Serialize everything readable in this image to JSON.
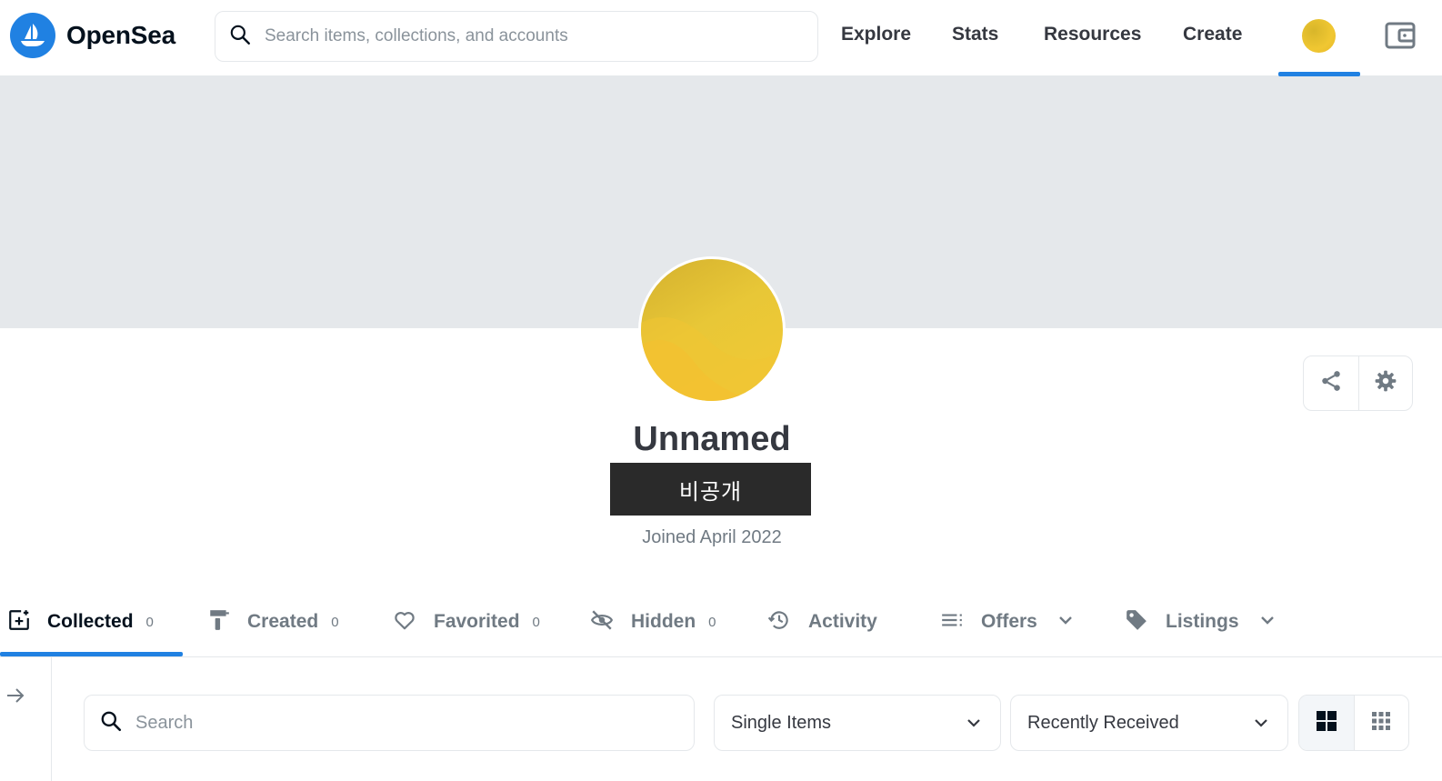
{
  "header": {
    "brand": "OpenSea",
    "search_placeholder": "Search items, collections, and accounts",
    "nav": [
      "Explore",
      "Stats",
      "Resources",
      "Create"
    ]
  },
  "profile": {
    "name": "Unnamed",
    "address_badge": "비공개",
    "joined": "Joined April 2022"
  },
  "tabs": [
    {
      "label": "Collected",
      "count": "0",
      "icon": "collected-icon"
    },
    {
      "label": "Created",
      "count": "0",
      "icon": "paintbrush-icon"
    },
    {
      "label": "Favorited",
      "count": "0",
      "icon": "heart-icon"
    },
    {
      "label": "Hidden",
      "count": "0",
      "icon": "eye-off-icon"
    },
    {
      "label": "Activity",
      "icon": "history-icon"
    },
    {
      "label": "Offers",
      "icon": "list-icon"
    },
    {
      "label": "Listings",
      "icon": "tag-icon"
    }
  ],
  "filters": {
    "search_placeholder": "Search",
    "type_selected": "Single Items",
    "sort_selected": "Recently Received"
  },
  "colors": {
    "accent": "#2081e2",
    "banner": "#e5e8eb",
    "avatar": "#ecc534"
  }
}
